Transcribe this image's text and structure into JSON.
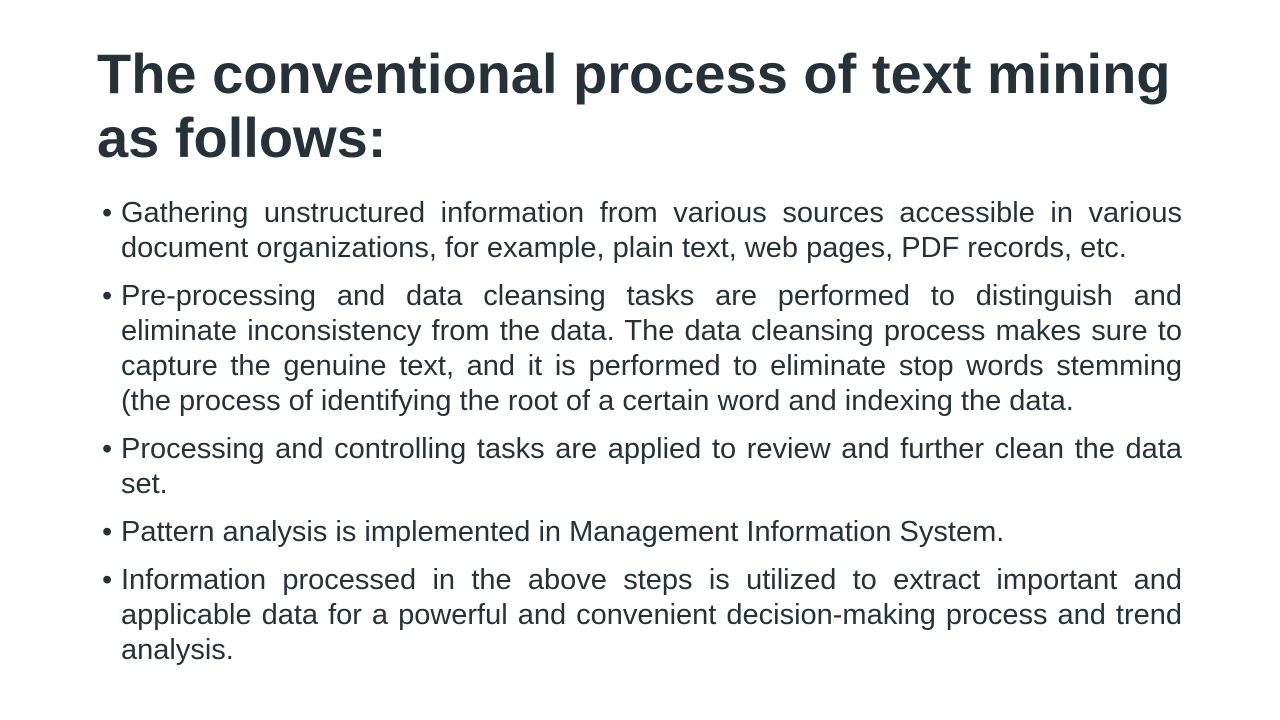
{
  "slide": {
    "title": "The conventional process of text mining as follows:",
    "bullet_symbol": "•",
    "bullets": [
      "Gathering unstructured information from various sources accessible in various document organizations, for example, plain text, web pages, PDF records, etc.",
      "Pre-processing and data cleansing tasks are performed to distinguish and eliminate inconsistency from the data. The data cleansing process makes sure to capture the genuine text, and it is performed to eliminate stop words stemming (the process of identifying the root of a certain word and indexing the data.",
      "Processing and controlling tasks are applied to review and further clean the data set.",
      "Pattern analysis is implemented in Management Information System.",
      "Information processed in the above steps is utilized to extract important and applicable data for a powerful and convenient decision-making process and trend analysis."
    ]
  }
}
